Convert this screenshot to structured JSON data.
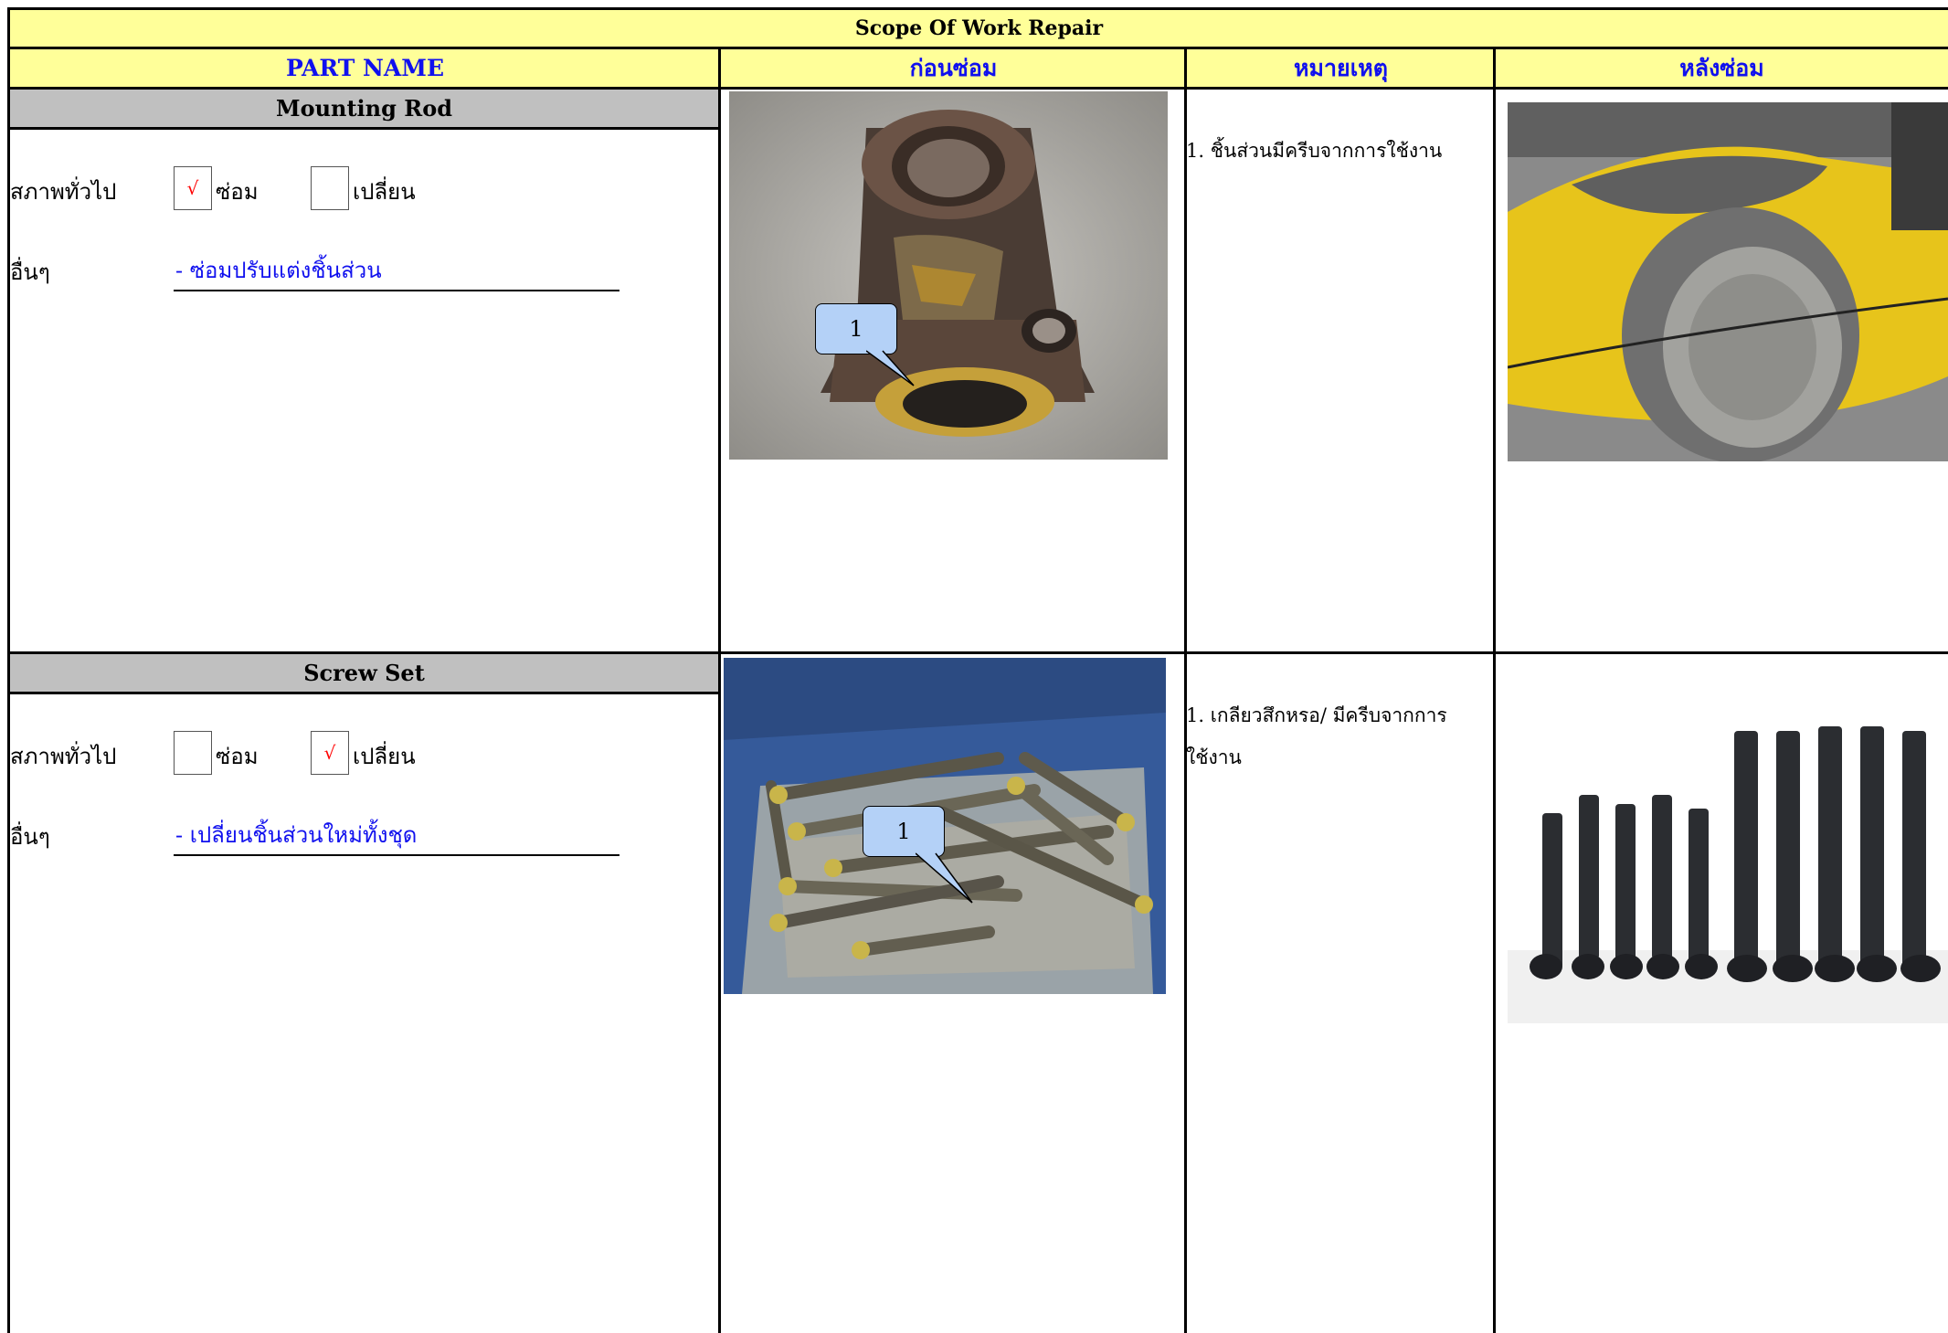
{
  "title": "Scope Of Work Repair",
  "headers": {
    "part_name": "PART NAME",
    "before": "ก่อนซ่อม",
    "remark": "หมายเหตุ",
    "after": "หลังซ่อม"
  },
  "status_label": "สภาพทั่วไป",
  "other_label": "อื่นๆ",
  "repair_label": "ซ่อม",
  "replace_label": "เปลี่ยน",
  "check_mark": "√",
  "colors": {
    "header_bg": "#ffff99",
    "header_text": "#1010ee",
    "partname_bg": "#c0c0c0",
    "check": "#ff0000"
  },
  "rows": [
    {
      "part": "Mounting Rod",
      "repair_checked": true,
      "replace_checked": false,
      "other": "- ซ่อมปรับแต่งชิ้นส่วน",
      "callout": "1",
      "note_lines": [
        "1. ชิ้นส่วนมีครีบจากการใช้งาน"
      ]
    },
    {
      "part": "Screw Set",
      "repair_checked": false,
      "replace_checked": true,
      "other": "- เปลี่ยนชิ้นส่วนใหม่ทั้งชุด",
      "callout": "1",
      "note_lines": [
        "1. เกลียวสึกหรอ/ มีครีบจากการ",
        "ใช้งาน"
      ]
    }
  ]
}
